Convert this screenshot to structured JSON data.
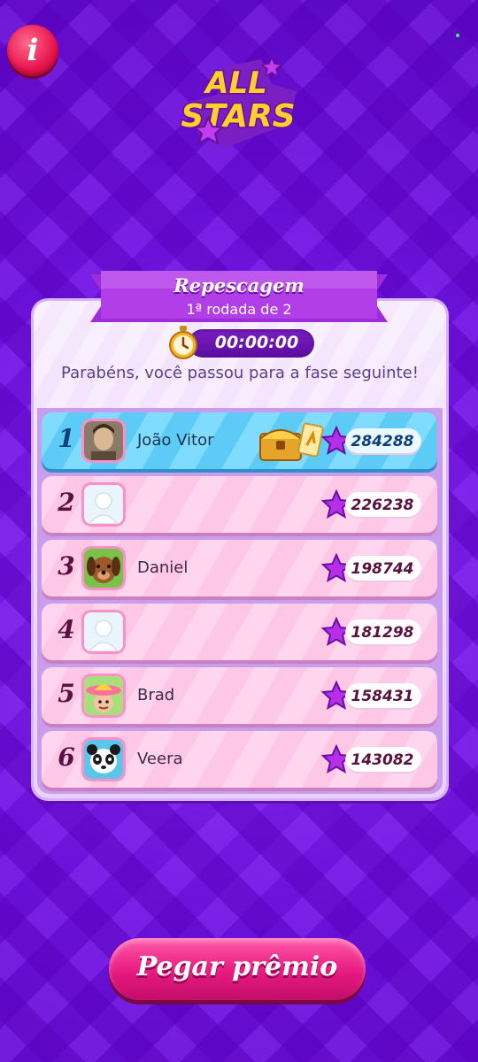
{
  "header": {
    "info_icon": "info-icon",
    "logo": {
      "line1": "ALL",
      "line2": "STARS"
    }
  },
  "panel": {
    "title": "Repescagem",
    "subtitle": "1ª rodada de 2",
    "timer": "00:00:00",
    "message": "Parabéns, você passou para a fase seguinte!"
  },
  "leaderboard": [
    {
      "rank": "1",
      "name": "João Vitor",
      "score": "284288",
      "avatar": "photo-avatar",
      "reward": "treasure-chest-icon"
    },
    {
      "rank": "2",
      "name": "",
      "score": "226238",
      "avatar": "default-avatar"
    },
    {
      "rank": "3",
      "name": "Daniel",
      "score": "198744",
      "avatar": "dog-avatar"
    },
    {
      "rank": "4",
      "name": "",
      "score": "181298",
      "avatar": "default-avatar"
    },
    {
      "rank": "5",
      "name": "Brad",
      "score": "158431",
      "avatar": "hat-avatar"
    },
    {
      "rank": "6",
      "name": "Veera",
      "score": "143082",
      "avatar": "panda-avatar"
    }
  ],
  "actions": {
    "claim_label": "Pegar prêmio"
  },
  "colors": {
    "accent": "#e81a80",
    "background": "#6a10d8",
    "highlight_row": "#5ccbf6"
  }
}
